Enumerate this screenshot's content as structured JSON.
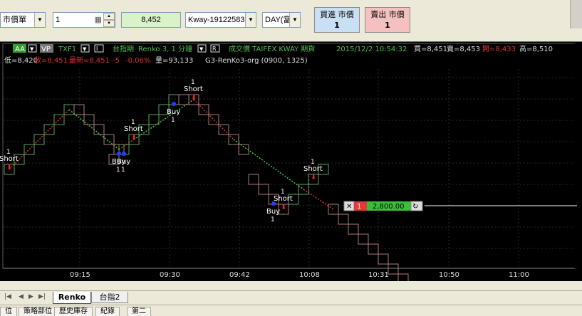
{
  "order_bar": {
    "order_type": "市價單",
    "quantity": "1",
    "price": "8,452",
    "symbol": "Kway-19122583",
    "session": "DAY(當",
    "buy_button": {
      "label": "買進 市價",
      "qty": "1"
    },
    "sell_button": {
      "label": "賣出 市價",
      "qty": "1"
    }
  },
  "chart_header": {
    "badge_aa": "AA",
    "badge_vp": "VP",
    "symbol": "TXF1",
    "ctrl_i": "I",
    "name": "台指期",
    "interval": "Renko 3, 1 分鐘",
    "ctrl_r": "R",
    "source": "成交價 TAIFEX KWAY 期貨",
    "datetime": "2015/12/2 10:54:32",
    "bid": "買=8,451",
    "ask": "賣=8,453",
    "open": "開=8,433",
    "high": "高=8,510",
    "low": "低=8,420",
    "close": "收=8,451",
    "last": "最新=8,451",
    "change": "-5",
    "change_pct": "-0.06%",
    "volume": "量=93,133",
    "strategy": "G3-RenKo3-org (0900, 1325)"
  },
  "chart_data": {
    "type": "renko",
    "x_ticks": [
      "09:15",
      "09:30",
      "09:42",
      "10:08",
      "10:31",
      "10:50",
      "11:00"
    ],
    "bricks": [
      [
        0,
        0
      ],
      [
        1,
        1
      ],
      [
        2,
        2
      ],
      [
        3,
        3
      ],
      [
        4,
        4
      ],
      [
        5,
        5
      ],
      [
        6,
        6
      ],
      [
        7,
        6
      ],
      [
        8,
        5
      ],
      [
        9,
        4
      ],
      [
        10,
        3
      ],
      [
        11,
        2
      ],
      [
        10.5,
        1
      ],
      [
        11.5,
        2
      ],
      [
        12.5,
        3
      ],
      [
        13.5,
        4
      ],
      [
        14.5,
        5
      ],
      [
        15.5,
        6
      ],
      [
        16.5,
        7
      ],
      [
        17.5,
        7
      ],
      [
        18.5,
        7
      ],
      [
        19.5,
        6
      ],
      [
        20.5,
        5
      ],
      [
        21.5,
        4
      ],
      [
        22.5,
        3
      ],
      [
        23.5,
        2
      ],
      [
        24.5,
        -1
      ],
      [
        25.5,
        -2
      ],
      [
        26.5,
        -3
      ],
      [
        27.5,
        -4
      ],
      [
        28.5,
        -3
      ],
      [
        29.5,
        -2
      ],
      [
        30.5,
        -1
      ],
      [
        31.5,
        0
      ],
      [
        32.5,
        -4
      ],
      [
        33.5,
        -5
      ],
      [
        34.5,
        -6
      ],
      [
        35.5,
        -7
      ],
      [
        36.5,
        -8
      ],
      [
        37.5,
        -9
      ],
      [
        38.5,
        -10
      ],
      [
        39.5,
        -11
      ]
    ],
    "order_line_value": "2,800.00",
    "order_line_qty": "1",
    "signal_labels": {
      "short": "Short",
      "buy": "Buy",
      "count": "1"
    }
  },
  "tabs": [
    "Renko",
    "台指2"
  ],
  "bottom_tabs": [
    "位",
    "策略部位",
    "歷史庫存",
    "紀錄",
    "第二"
  ]
}
